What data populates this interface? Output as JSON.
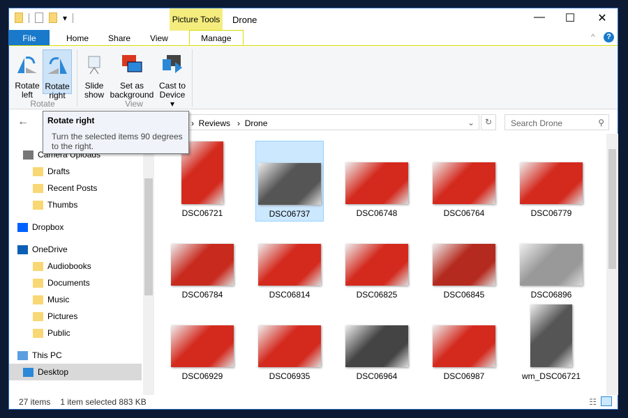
{
  "window": {
    "title": "Drone",
    "context_tab": "Picture Tools",
    "minimize": "—",
    "maximize": "☐",
    "close": "✕"
  },
  "tabs": [
    "File",
    "Home",
    "Share",
    "View",
    "Manage"
  ],
  "ribbon": {
    "rotate_left": "Rotate left",
    "rotate_right": "Rotate right",
    "group_rotate": "Rotate",
    "slide_show": "Slide show",
    "set_background": "Set as background",
    "cast": "Cast to Device ▾",
    "group_view": "View",
    "collapse": "^",
    "help": "?"
  },
  "tooltip": {
    "title": "Rotate right",
    "text": "Turn the selected items 90 degrees to the right."
  },
  "address": {
    "path": [
      "Reviews",
      "Drone"
    ],
    "search_placeholder": "Search Drone"
  },
  "nav": [
    {
      "label": "Camera Uploads",
      "icon": "camera-icon"
    },
    {
      "label": "Drafts",
      "icon": "folder-icon"
    },
    {
      "label": "Recent Posts",
      "icon": "folder-icon"
    },
    {
      "label": "Thumbs",
      "icon": "folder-icon"
    },
    {
      "label": "Dropbox",
      "icon": "dropbox-icon"
    },
    {
      "label": "OneDrive",
      "icon": "cloud-icon"
    },
    {
      "label": "Audiobooks",
      "icon": "folder-icon"
    },
    {
      "label": "Documents",
      "icon": "folder-icon"
    },
    {
      "label": "Music",
      "icon": "folder-icon"
    },
    {
      "label": "Pictures",
      "icon": "folder-icon"
    },
    {
      "label": "Public",
      "icon": "folder-icon"
    },
    {
      "label": "This PC",
      "icon": "computer-icon"
    },
    {
      "label": "Desktop",
      "icon": "desktop-icon"
    }
  ],
  "files": [
    "DSC06721",
    "DSC06737",
    "DSC06748",
    "DSC06764",
    "DSC06779",
    "DSC06784",
    "DSC06814",
    "DSC06825",
    "DSC06845",
    "DSC06896",
    "DSC06929",
    "DSC06935",
    "DSC06964",
    "DSC06987",
    "wm_DSC06721"
  ],
  "selected_file": "DSC06737",
  "status": {
    "count": "27 items",
    "selection": "1 item selected  883 KB"
  }
}
